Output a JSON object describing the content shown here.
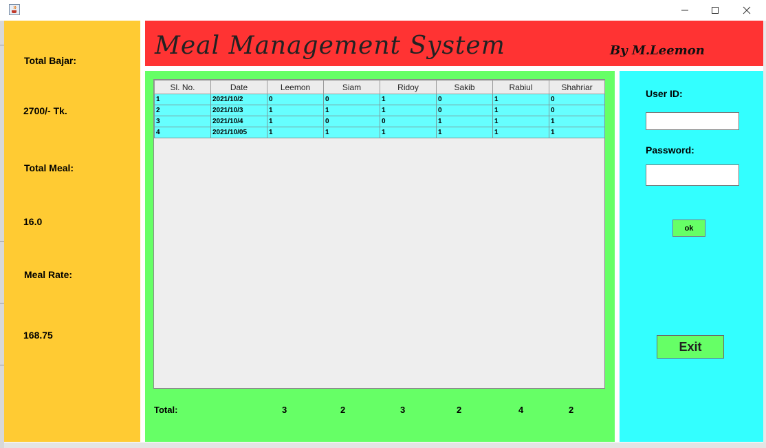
{
  "window": {
    "icon": "java-cup-icon",
    "controls": [
      "minimize-icon",
      "maximize-icon",
      "close-icon"
    ]
  },
  "header": {
    "title": "Meal Management System",
    "author": "By M.Leemon"
  },
  "summary": {
    "total_bajar_label": "Total Bajar:",
    "total_bajar_value": "2700/- Tk.",
    "total_meal_label": "Total Meal:",
    "total_meal_value": "16.0",
    "meal_rate_label": "Meal Rate:",
    "meal_rate_value": "168.75"
  },
  "table": {
    "columns": [
      "Sl. No.",
      "Date",
      "Leemon",
      "Siam",
      "Ridoy",
      "Sakib",
      "Rabiul",
      "Shahriar"
    ],
    "rows": [
      [
        "1",
        "2021/10/2",
        "0",
        "0",
        "1",
        "0",
        "1",
        "0"
      ],
      [
        "2",
        "2021/10/3",
        "1",
        "1",
        "1",
        "0",
        "1",
        "0"
      ],
      [
        "3",
        "2021/10/4",
        "1",
        "0",
        "0",
        "1",
        "1",
        "1"
      ],
      [
        "4",
        "2021/10/05",
        "1",
        "1",
        "1",
        "1",
        "1",
        "1"
      ]
    ]
  },
  "totals": {
    "label": "Total:",
    "values": [
      "3",
      "2",
      "3",
      "2",
      "4",
      "2"
    ]
  },
  "login": {
    "user_id_label": "User ID:",
    "user_id_value": "",
    "password_label": "Password:",
    "password_value": "",
    "ok_label": "ok",
    "exit_label": "Exit"
  },
  "colors": {
    "summary_panel": "#ffcb33",
    "header": "#ff3333",
    "table_panel": "#66ff66",
    "login_panel": "#33ffff",
    "table_rows": "#66ffff"
  }
}
